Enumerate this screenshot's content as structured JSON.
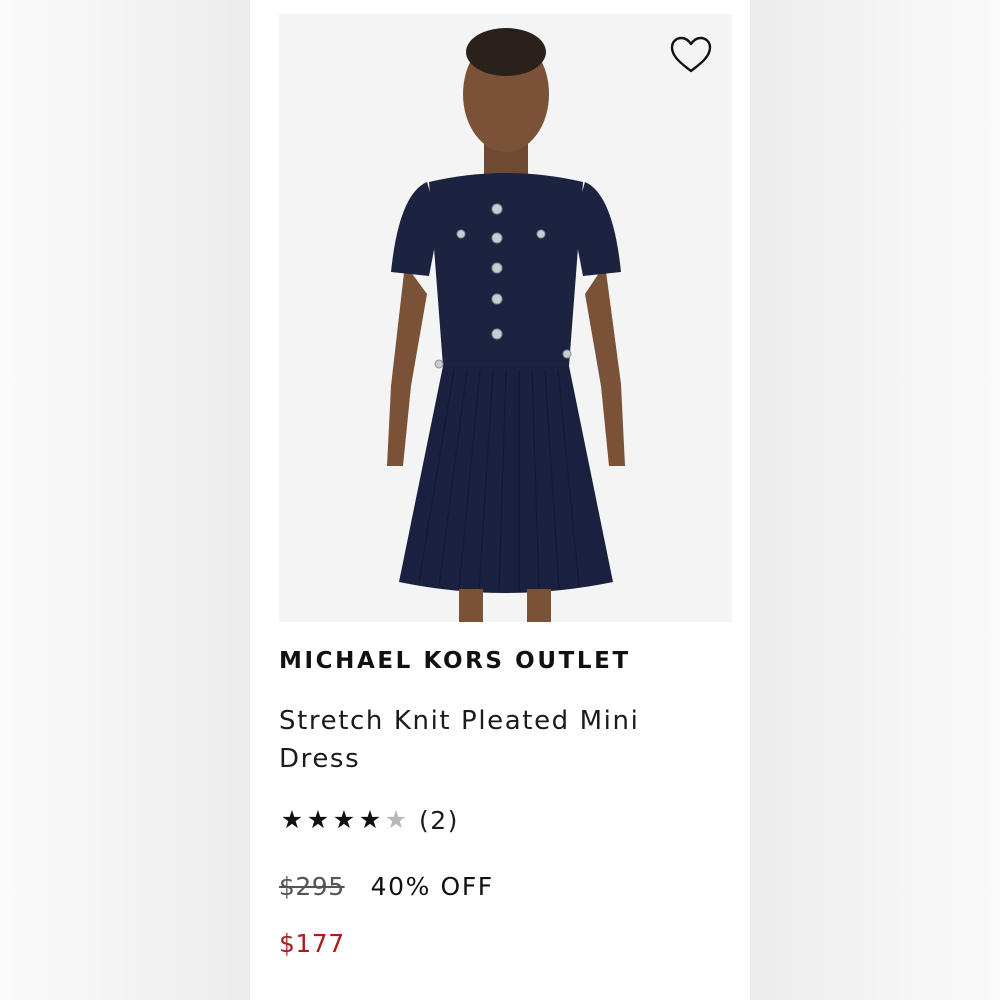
{
  "product": {
    "brand": "MICHAEL KORS OUTLET",
    "name": "Stretch Knit Pleated Mini Dress",
    "rating": 4,
    "rating_max": 5,
    "review_count": "(2)",
    "original_price": "$295",
    "discount": "40% OFF",
    "sale_price": "$177",
    "image_subject": "model wearing navy short-sleeve knit dress with silver buttons and pleated skirt"
  },
  "icons": {
    "wishlist": "heart-outline-icon",
    "rating_star_filled": "star-filled-icon",
    "rating_star_empty": "star-empty-icon"
  },
  "colors": {
    "sale_price": "#b2181b",
    "dress": "#1c2340",
    "star_filled": "#111111",
    "star_empty": "#b8b8b8"
  }
}
